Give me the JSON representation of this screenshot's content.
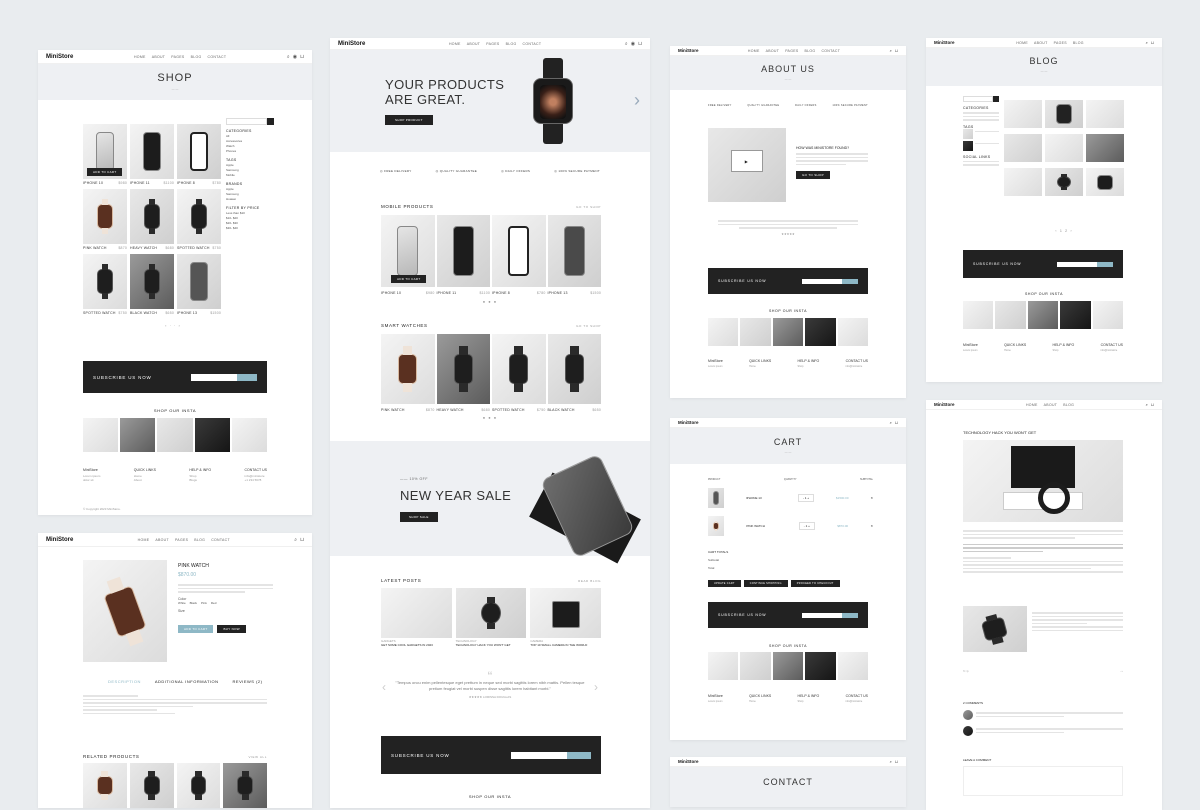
{
  "brand": "MiniStore",
  "nav": [
    "HOME",
    "ABOUT",
    "PAGES",
    "BLOG",
    "CONTACT"
  ],
  "shop": {
    "title": "SHOP",
    "search_placeholder": "Search",
    "categories_title": "CATEGORIES",
    "categories": [
      "All",
      "Accessories",
      "Watch",
      "Phones"
    ],
    "tags_title": "TAGS",
    "tags": [
      "Apple",
      "Samsung",
      "Mobile"
    ],
    "brands_title": "BRANDS",
    "brands": [
      "Apple",
      "Samsung",
      "Huawei"
    ],
    "filter_title": "FILTER BY PRICE",
    "filters": [
      "Less than $10",
      "$10- $20",
      "$20- $30",
      "$30- $40"
    ],
    "products": [
      {
        "name": "IPHONE 10",
        "price": "$980"
      },
      {
        "name": "IPHONE 11",
        "price": "$1100"
      },
      {
        "name": "IPHONE 8",
        "price": "$780"
      },
      {
        "name": "PINK WATCH",
        "price": "$870"
      },
      {
        "name": "HEAVY WATCH",
        "price": "$680"
      },
      {
        "name": "SPOTTED WATCH",
        "price": "$750"
      },
      {
        "name": "SPOTTED WATCH",
        "price": "$750"
      },
      {
        "name": "BLACK WATCH",
        "price": "$650"
      },
      {
        "name": "IPHONE 13",
        "price": "$1500"
      }
    ],
    "add_to_cart": "ADD TO CART"
  },
  "subscribe": {
    "title": "SUBSCRIBE US NOW",
    "button": "SUBSCRIBE"
  },
  "insta_title": "SHOP OUR INSTA",
  "footer": {
    "cols": [
      "QUICK LINKS",
      "HELP & INFO",
      "CONTACT US"
    ],
    "links": [
      "Home",
      "About",
      "Shop",
      "Blogs",
      "Contact"
    ],
    "copyright": "© Copyright 2023 MiniStore."
  },
  "home": {
    "hero_title_1": "YOUR PRODUCTS",
    "hero_title_2": "ARE GREAT.",
    "hero_button": "SHOP PRODUCT",
    "features": [
      "FREE DELIVERY",
      "QUALITY GUARANTEE",
      "DAILY OFFERS",
      "100% SECURE PAYMENT"
    ],
    "mobile_title": "MOBILE PRODUCTS",
    "watch_title": "SMART WATCHES",
    "go_shop": "GO TO SHOP",
    "mobiles": [
      {
        "name": "IPHONE 10",
        "price": "$980"
      },
      {
        "name": "IPHONE 11",
        "price": "$1100"
      },
      {
        "name": "IPHONE 8",
        "price": "$780"
      },
      {
        "name": "IPHONE 13",
        "price": "$1500"
      }
    ],
    "watches": [
      {
        "name": "PINK WATCH",
        "price": "$870"
      },
      {
        "name": "HEAVY WATCH",
        "price": "$680"
      },
      {
        "name": "SPOTTED WATCH",
        "price": "$750"
      },
      {
        "name": "BLACK WATCH",
        "price": "$650"
      }
    ],
    "sale_small": "10% OFF",
    "sale_title": "NEW YEAR SALE",
    "sale_button": "SHOP SALE",
    "posts_title": "LATEST POSTS",
    "read_blog": "READ BLOG",
    "posts": [
      {
        "cat": "GADGETS",
        "title": "GET SOME COOL GADGETS IN 2023"
      },
      {
        "cat": "TECHNOLOGY",
        "title": "TECHNOLOGY HACK YOU WON'T GET"
      },
      {
        "cat": "CAMERA",
        "title": "TOP 10 SMALL CAMERA IN THE WORLD"
      }
    ],
    "quote": "\"Tempus oncu enim pellentesque eget prettum in neque sed morbi sagittis lorem nibh mattis. Pellen tesque pretium feugiat vel morbi suspen disse sagittis lorem habitant morbi.\"",
    "quote_author": "LORISSA DOUGLAS"
  },
  "about": {
    "title": "ABOUT US",
    "features": [
      "FREE DELIVERY",
      "QUALITY GUARANTEE",
      "DAILY OFFERS",
      "100% SECURE PAYMENT"
    ],
    "how_title": "HOW WAS MINISTORE FOUND?",
    "button": "GO TO SHOP"
  },
  "blog": {
    "title": "BLOG",
    "sidebar": [
      "CATEGORIES",
      "TAGS",
      "SOCIAL LINKS"
    ]
  },
  "cart": {
    "title": "CART",
    "headers": [
      "PRODUCT",
      "QUANTITY",
      "SUBTOTAL"
    ],
    "items": [
      {
        "name": "IPHONE 13",
        "price": "$1500.00"
      },
      {
        "name": "PINK WATCH",
        "price": "$870.00"
      }
    ],
    "totals_title": "CART TOTALS",
    "subtotal_label": "Subtotal",
    "total_label": "Total",
    "buttons": [
      "UPDATE CART",
      "CONTINUE SHOPPING",
      "PROCEED TO CHECKOUT"
    ]
  },
  "product": {
    "name": "PINK WATCH",
    "price": "$870.00",
    "color_label": "Color",
    "colors": [
      "White",
      "Black",
      "Pink",
      "Red"
    ],
    "size_label": "Size",
    "add_button": "ADD TO CART",
    "buy_button": "BUY NOW",
    "tabs": [
      "DESCRIPTION",
      "ADDITIONAL INFORMATION",
      "REVIEWS (2)"
    ],
    "related": "RELATED PRODUCTS",
    "view_all": "VIEW ALL"
  },
  "post": {
    "title": "TECHNOLOGY HACK YOU WON'T GET",
    "comments": "2 COMMENTS",
    "leave": "LEAVE A COMMENT"
  },
  "contact": {
    "title": "CONTACT"
  }
}
